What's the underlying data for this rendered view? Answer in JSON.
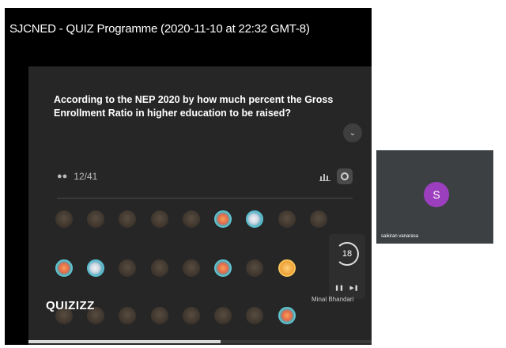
{
  "window": {
    "title": "SJCNED - QUIZ Programme (2020-11-10 at 22:32 GMT-8)"
  },
  "quiz": {
    "question": "According to the NEP 2020 by how much percent the Gross Enrollment Ratio in higher education to be raised?",
    "players_icon": "people-icon",
    "players_count": "12/41",
    "timer_value": "18",
    "player_name": "Minal Bhandari",
    "logo": "QUIZIZZ",
    "progress_percent": 56,
    "avatar_rows": [
      [
        "dim",
        "dim",
        "dim",
        "dim",
        "dim",
        "bright",
        "bright2",
        "dim",
        "dim"
      ],
      [
        "bright",
        "bright2",
        "dim",
        "dim",
        "dim",
        "bright",
        "dim",
        "bright3"
      ],
      [
        "dim",
        "dim",
        "dim",
        "dim",
        "dim",
        "dim",
        "dim",
        "bright"
      ]
    ]
  },
  "participant_tile": {
    "initial": "S",
    "name": "saikiran vanarasa",
    "avatar_color": "#9c3fbf"
  },
  "colors": {
    "panel_bg": "#262626",
    "screen_bg": "#000000",
    "tile_bg": "#3c4043"
  }
}
